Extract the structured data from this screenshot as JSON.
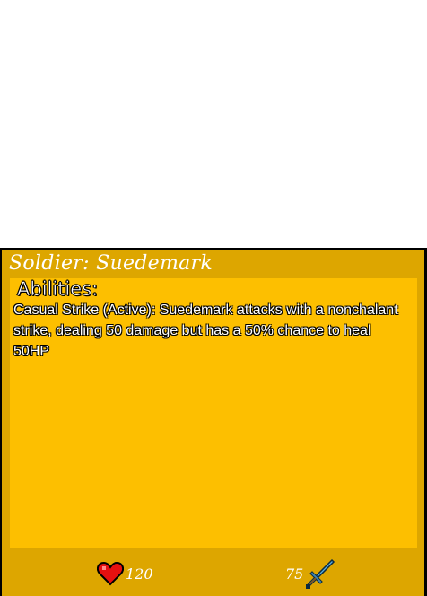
{
  "card": {
    "title": "Soldier: Suedemark",
    "abilities_heading": "Abilities:",
    "ability_text": "Casual Strike (Active): Suedemark attacks with a nonchalant strike, dealing 50 damage but has a 50% chance to heal 50HP",
    "health": "120",
    "attack": "75",
    "health_icon": "heart-icon",
    "attack_icon": "sword-icon"
  },
  "colors": {
    "card_border": "#dda600",
    "card_panel": "#fdbf00",
    "heart": "#e61010",
    "sword_blade": "#5aaee0"
  }
}
